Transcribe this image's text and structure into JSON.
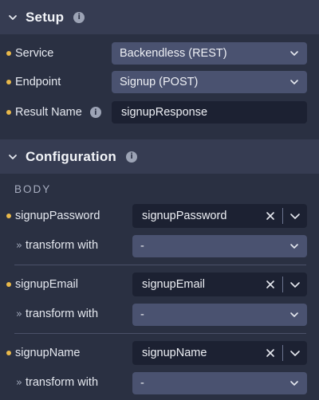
{
  "setup": {
    "title": "Setup",
    "info_icon": "info-icon",
    "service": {
      "label": "Service",
      "value": "Backendless (REST)"
    },
    "endpoint": {
      "label": "Endpoint",
      "value": "Signup (POST)"
    },
    "result_name": {
      "label": "Result Name",
      "value": "signupResponse"
    }
  },
  "configuration": {
    "title": "Configuration",
    "body_caption": "BODY",
    "fields": [
      {
        "label": "signupPassword",
        "value": "signupPassword",
        "transform_label": "transform with",
        "transform_value": "-"
      },
      {
        "label": "signupEmail",
        "value": "signupEmail",
        "transform_label": "transform with",
        "transform_value": "-"
      },
      {
        "label": "signupName",
        "value": "signupName",
        "transform_label": "transform with",
        "transform_value": "-"
      }
    ]
  },
  "colors": {
    "background": "#2a3042",
    "header": "#363c52",
    "select": "#4a5270",
    "input": "#1c2132",
    "required_dot": "#e8b84a"
  },
  "icons": {
    "collapse": "chevron-down-icon",
    "info": "info-icon",
    "clear": "close-icon",
    "dropdown": "chevron-down-icon",
    "transform": "double-chevron-right-icon"
  }
}
